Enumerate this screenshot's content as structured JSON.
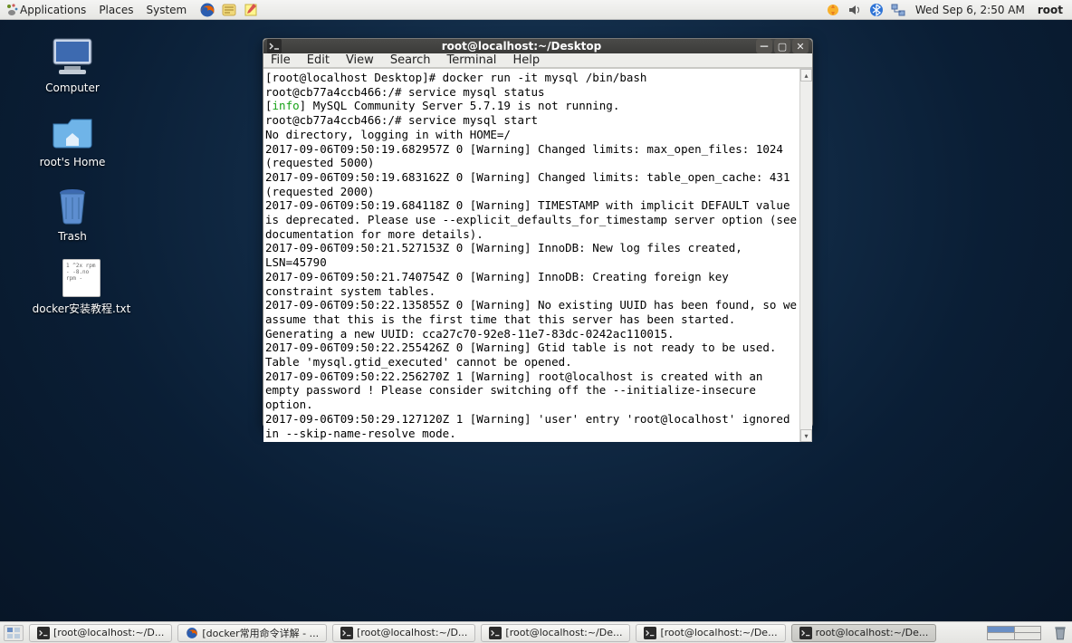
{
  "top_panel": {
    "menus": [
      "Applications",
      "Places",
      "System"
    ],
    "launchers": [
      "firefox-icon",
      "help-icon",
      "notes-icon"
    ],
    "tray": [
      "updates-icon",
      "volume-icon",
      "bluetooth-icon",
      "network-icon"
    ],
    "clock": "Wed Sep  6,  2:50 AM",
    "user": "root"
  },
  "desktop_icons": [
    {
      "name": "computer",
      "label": "Computer",
      "icon": "monitor-icon"
    },
    {
      "name": "home",
      "label": "root's Home",
      "icon": "folder-home-icon"
    },
    {
      "name": "trash",
      "label": "Trash",
      "icon": "trash-icon"
    },
    {
      "name": "docker-txt",
      "label": "docker安装教程.txt",
      "icon": "text-file-icon",
      "preview": "1  ^2x\nrpm -\n -8.no\nrpm -"
    }
  ],
  "terminal": {
    "title": "root@localhost:~/Desktop",
    "menubar": [
      "File",
      "Edit",
      "View",
      "Search",
      "Terminal",
      "Help"
    ],
    "lines": [
      {
        "t": "[root@localhost Desktop]# docker run -it mysql /bin/bash"
      },
      {
        "t": "root@cb77a4ccb466:/# service mysql status"
      },
      {
        "prefix": "[",
        "info": "info",
        "suffix": "] MySQL Community Server 5.7.19 is not running."
      },
      {
        "t": "root@cb77a4ccb466:/# service mysql start"
      },
      {
        "t": "No directory, logging in with HOME=/"
      },
      {
        "t": "2017-09-06T09:50:19.682957Z 0 [Warning] Changed limits: max_open_files: 1024 (requested 5000)"
      },
      {
        "t": "2017-09-06T09:50:19.683162Z 0 [Warning] Changed limits: table_open_cache: 431 (requested 2000)"
      },
      {
        "t": "2017-09-06T09:50:19.684118Z 0 [Warning] TIMESTAMP with implicit DEFAULT value is deprecated. Please use --explicit_defaults_for_timestamp server option (see documentation for more details)."
      },
      {
        "t": "2017-09-06T09:50:21.527153Z 0 [Warning] InnoDB: New log files created, LSN=45790"
      },
      {
        "t": "2017-09-06T09:50:21.740754Z 0 [Warning] InnoDB: Creating foreign key constraint system tables."
      },
      {
        "t": "2017-09-06T09:50:22.135855Z 0 [Warning] No existing UUID has been found, so we assume that this is the first time that this server has been started. Generating a new UUID: cca27c70-92e8-11e7-83dc-0242ac110015."
      },
      {
        "t": "2017-09-06T09:50:22.255426Z 0 [Warning] Gtid table is not ready to be used. Table 'mysql.gtid_executed' cannot be opened."
      },
      {
        "t": "2017-09-06T09:50:22.256270Z 1 [Warning] root@localhost is created with an empty password ! Please consider switching off the --initialize-insecure option."
      },
      {
        "t": "2017-09-06T09:50:29.127120Z 1 [Warning] 'user' entry 'root@localhost' ignored in --skip-name-resolve mode."
      }
    ]
  },
  "taskbar": {
    "tasks": [
      {
        "icon": "terminal-icon",
        "label": "[root@localhost:~/D...",
        "active": false
      },
      {
        "icon": "firefox-icon",
        "label": "[docker常用命令详解 - ...",
        "active": false
      },
      {
        "icon": "terminal-icon",
        "label": "[root@localhost:~/D...",
        "active": false
      },
      {
        "icon": "terminal-icon",
        "label": "[root@localhost:~/De...",
        "active": false
      },
      {
        "icon": "terminal-icon",
        "label": "[root@localhost:~/De...",
        "active": false
      },
      {
        "icon": "terminal-icon",
        "label": "root@localhost:~/De...",
        "active": true
      }
    ],
    "active_workspace": 0
  }
}
